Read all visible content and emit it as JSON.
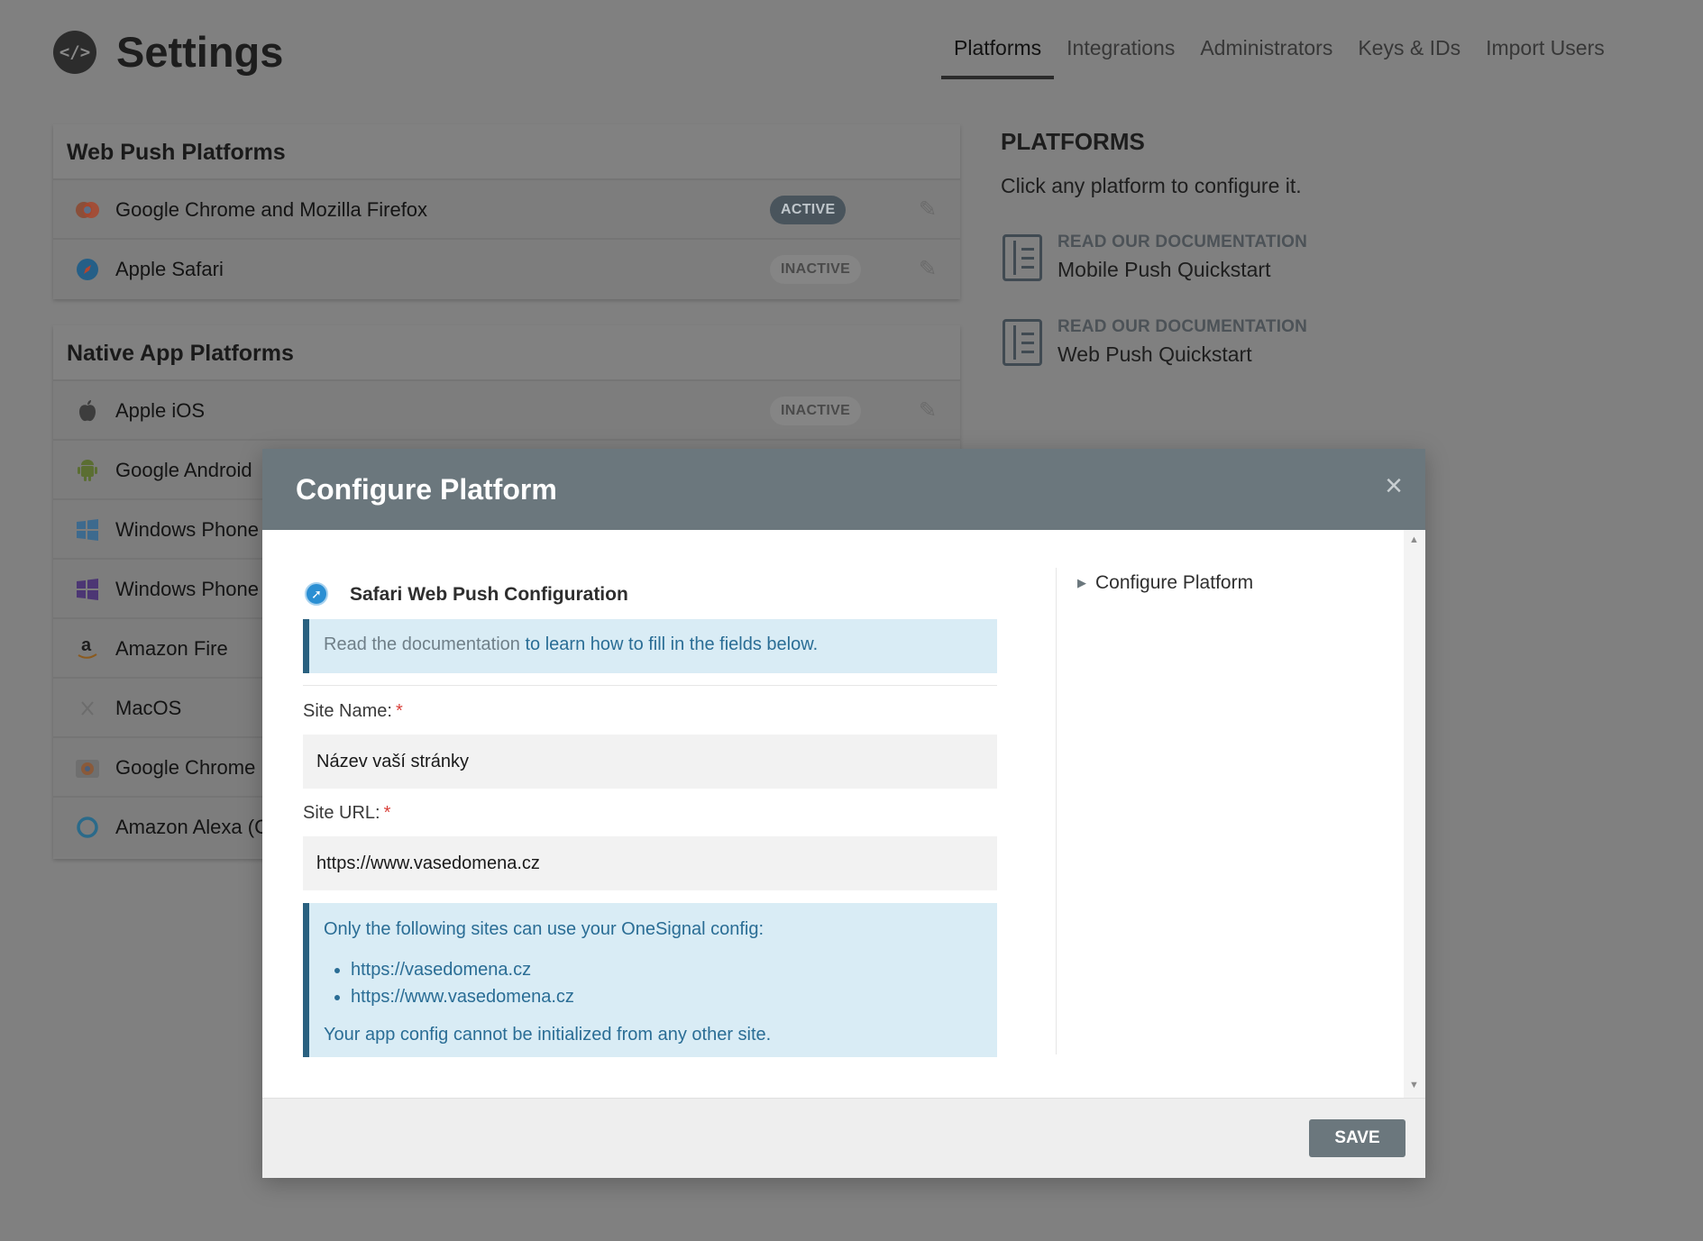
{
  "header": {
    "logo_glyph": "</>",
    "title": "Settings",
    "tabs": [
      {
        "label": "Platforms",
        "active": true
      },
      {
        "label": "Integrations",
        "active": false
      },
      {
        "label": "Administrators",
        "active": false
      },
      {
        "label": "Keys & IDs",
        "active": false
      },
      {
        "label": "Import Users",
        "active": false
      }
    ]
  },
  "web_push": {
    "title": "Web Push Platforms",
    "rows": [
      {
        "label": "Google Chrome and Mozilla Firefox",
        "icon": "chrome-firefox-icon",
        "status": "ACTIVE"
      },
      {
        "label": "Apple Safari",
        "icon": "safari-icon",
        "status": "INACTIVE"
      }
    ]
  },
  "native": {
    "title": "Native App Platforms",
    "rows": [
      {
        "label": "Apple iOS",
        "icon": "apple-icon",
        "status": "INACTIVE"
      },
      {
        "label": "Google Android",
        "icon": "android-icon"
      },
      {
        "label": "Windows Phone",
        "icon": "windows-icon"
      },
      {
        "label": "Windows Phone",
        "icon": "windows-purple-icon"
      },
      {
        "label": "Amazon Fire",
        "icon": "amazon-icon"
      },
      {
        "label": "MacOS",
        "icon": "macos-icon"
      },
      {
        "label": "Google Chrome",
        "icon": "chrome-icon"
      },
      {
        "label": "Amazon Alexa (C",
        "icon": "alexa-icon"
      }
    ]
  },
  "side": {
    "heading": "PLATFORMS",
    "subtitle": "Click any platform to configure it.",
    "docs": [
      {
        "kicker": "READ OUR DOCUMENTATION",
        "title": "Mobile Push Quickstart"
      },
      {
        "kicker": "READ OUR DOCUMENTATION",
        "title": "Web Push Quickstart"
      }
    ]
  },
  "modal": {
    "title": "Configure Platform",
    "close": "×",
    "config_title": "Safari Web Push Configuration",
    "doc_prefix": "Read the documentation",
    "doc_link": " to learn how to fill in the fields below.",
    "site_name_label": "Site Name:",
    "site_name_value": "Název vaší stránky",
    "site_url_label": "Site URL:",
    "site_url_value": "https://www.vasedomena.cz",
    "required_mark": "*",
    "sites_intro": "Only the following sites can use your OneSignal config:",
    "sites": [
      "https://vasedomena.cz",
      "https://www.vasedomena.cz"
    ],
    "sites_footer": "Your app config cannot be initialized from any other site.",
    "toc_item": "Configure Platform",
    "save_label": "SAVE"
  },
  "colors": {
    "modal_header": "#6b777d",
    "info_bg": "#d9ecf5",
    "info_border": "#2a6180",
    "link": "#2a6d95",
    "overlay": "#808080"
  }
}
